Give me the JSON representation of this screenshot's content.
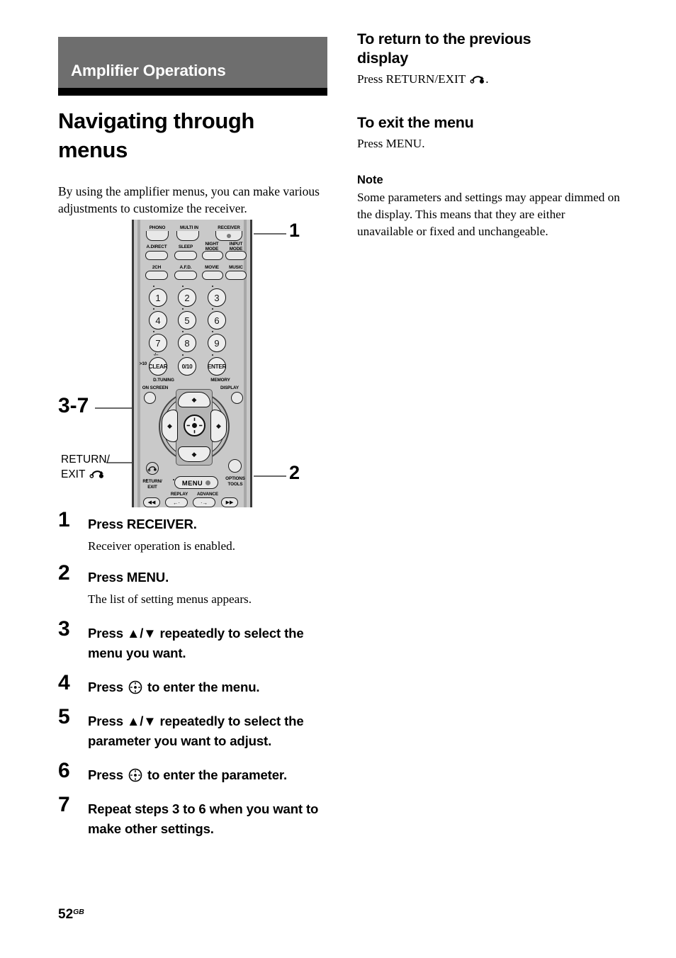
{
  "chapter": {
    "banner_label": "Amplifier Operations"
  },
  "section": {
    "title": "Navigating through menus",
    "intro": "By using the amplifier menus, you can make various adjustments to customize the receiver."
  },
  "figure": {
    "callout_1": "1",
    "callout_2": "2",
    "callout_3_7": "3-7",
    "callout_return_exit_line1": "RETURN/",
    "callout_return_exit_line2": "EXIT",
    "remote": {
      "row_top": [
        "PHONO",
        "MULTI IN",
        "RECEIVER"
      ],
      "row_mode": [
        "A.DIRECT",
        "SLEEP",
        "NIGHT MODE",
        "INPUT MODE"
      ],
      "row_field": [
        "2CH",
        "A.F.D.",
        "MOVIE",
        "MUSIC"
      ],
      "keypad": [
        "1",
        "2",
        "3",
        "4",
        "5",
        "6",
        "7",
        "8",
        "9"
      ],
      "keypad_bottom": [
        ">10",
        "CLEAR",
        "0/10",
        "ENTER"
      ],
      "keypad_bottom_marks": "-/--",
      "sub_labels": [
        "D.TUNING",
        "MEMORY"
      ],
      "nav_side_left": "ON SCREEN",
      "nav_side_right": "DISPLAY",
      "return_exit_line1": "RETURN/",
      "return_exit_line2": "EXIT",
      "menu_button": "MENU",
      "options_line1": "OPTIONS",
      "options_line2": "TOOLS",
      "transport_labels": [
        "REPLAY",
        "ADVANCE"
      ],
      "transport_buttons": [
        "◀◀",
        "←·",
        "·→",
        "▶▶"
      ]
    }
  },
  "steps": [
    {
      "num": "1",
      "head": "Press RECEIVER.",
      "desc": "Receiver operation is enabled."
    },
    {
      "num": "2",
      "head": "Press MENU.",
      "desc": "The list of setting menus appears."
    },
    {
      "num": "3",
      "head_pre": "Press ",
      "head_arrows": "♦/♦",
      "head_post": " repeatedly to select the menu you want.",
      "desc": ""
    },
    {
      "num": "4",
      "head_pre": "Press ",
      "head_post": " to enter the menu.",
      "desc": ""
    },
    {
      "num": "5",
      "head_pre": "Press ",
      "head_arrows": "♦/♦",
      "head_post": " repeatedly to select the parameter you want to adjust.",
      "desc": ""
    },
    {
      "num": "6",
      "head_pre": "Press ",
      "head_post": " to enter the parameter.",
      "desc": ""
    },
    {
      "num": "7",
      "head": "Repeat steps 3 to 6 when you want to make other settings.",
      "desc": ""
    }
  ],
  "right": {
    "h_return_title": "To return to the previous display",
    "return_body_pre": "Press RETURN/EXIT",
    "return_body_post": ".",
    "h_exit_title": "To exit the menu",
    "exit_body": "Press MENU.",
    "note_title": "Note",
    "note_body": "Some parameters and settings may appear dimmed on the display. This means that they are either unavailable or fixed and unchangeable."
  },
  "footer": {
    "page_number": "52",
    "page_suffix": "GB"
  },
  "colors": {
    "banner_gray": "#6e6e6e",
    "rule_black": "#000000",
    "remote_body": "#c9c9c9"
  }
}
